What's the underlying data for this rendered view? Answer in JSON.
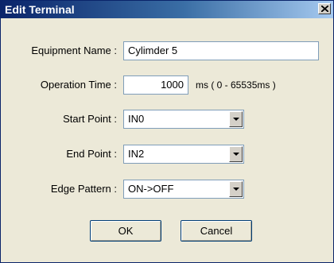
{
  "window": {
    "title": "Edit Terminal"
  },
  "form": {
    "equipment_name_label": "Equipment Name :",
    "equipment_name_value": "Cylimder 5",
    "operation_time_label": "Operation Time :",
    "operation_time_value": "1000",
    "operation_time_unit": "ms ( 0 - 65535ms )",
    "start_point_label": "Start Point :",
    "start_point_value": "IN0",
    "end_point_label": "End Point :",
    "end_point_value": "IN2",
    "edge_pattern_label": "Edge Pattern :",
    "edge_pattern_value": "ON->OFF"
  },
  "buttons": {
    "ok": "OK",
    "cancel": "Cancel"
  },
  "icons": {
    "close": "close-icon",
    "dropdown": "chevron-down-icon"
  },
  "colors": {
    "title_bar": "#0a246a",
    "face": "#ece9d8"
  }
}
